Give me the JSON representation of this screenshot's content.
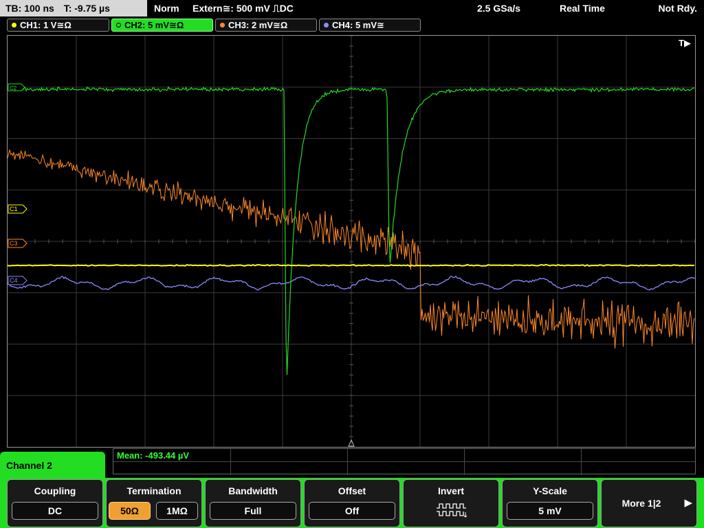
{
  "status": {
    "timebase": "TB: 100 ns",
    "trigger_pos": "T: -9.75 µs",
    "mode": "Norm",
    "trigger": "Extern≅: 500 mV ⎍DC",
    "sample_rate": "2.5 GSa/s",
    "acquisition": "Real Time",
    "state": "Not Rdy."
  },
  "channels": [
    {
      "label": "CH1: 1 V≅Ω",
      "color": "#ffff00"
    },
    {
      "label": "CH2: 5 mV≅Ω",
      "color": "#22dd22"
    },
    {
      "label": "CH3: 2 mV≅Ω",
      "color": "#ff8a2a"
    },
    {
      "label": "CH4: 5 mV≅",
      "color": "#8c8cff"
    }
  ],
  "markers": {
    "ch1": "C1",
    "ch2": "C2",
    "ch3": "C3",
    "ch4": "C4",
    "trigger": "T▶"
  },
  "measurement": {
    "mean": "Mean: -493.44 µV"
  },
  "menu": {
    "title": "Channel 2",
    "coupling": {
      "title": "Coupling",
      "value": "DC"
    },
    "termination": {
      "title": "Termination",
      "opt1": "50Ω",
      "opt2": "1MΩ"
    },
    "bandwidth": {
      "title": "Bandwidth",
      "value": "Full"
    },
    "offset": {
      "title": "Offset",
      "value": "Off"
    },
    "invert": {
      "title": "Invert",
      "icon": "invert-pulse-icon"
    },
    "yscale": {
      "title": "Y-Scale",
      "value": "5 mV"
    },
    "more": {
      "label": "More 1|2"
    }
  }
}
